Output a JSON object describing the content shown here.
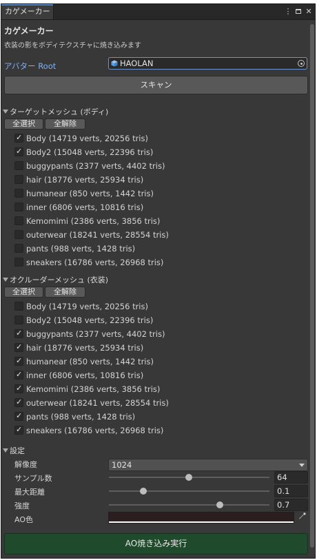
{
  "window": {
    "tab_title": "カゲメーカー",
    "icons": [
      "more-vert-icon",
      "maximize-icon",
      "close-icon"
    ]
  },
  "header": {
    "title": "カゲメーカー",
    "description": "衣装の影をボディテクスチャに焼き込みます"
  },
  "avatar": {
    "label": "アバター Root",
    "value": "HAOLAN"
  },
  "scan_button": "スキャン",
  "target_section": {
    "label": "ターゲットメッシュ (ボディ)",
    "select_all": "全選択",
    "deselect_all": "全解除",
    "items": [
      {
        "name": "Body",
        "info": "(14719 verts, 20256 tris)",
        "checked": true
      },
      {
        "name": "Body2",
        "info": "(15048 verts, 22396 tris)",
        "checked": true
      },
      {
        "name": "buggypants",
        "info": "(2377 verts, 4402 tris)",
        "checked": false
      },
      {
        "name": "hair",
        "info": "(18776 verts, 25934 tris)",
        "checked": false
      },
      {
        "name": "humanear",
        "info": "(850 verts, 1442 tris)",
        "checked": false
      },
      {
        "name": "inner",
        "info": "(6806 verts, 10816 tris)",
        "checked": false
      },
      {
        "name": "Kemomimi",
        "info": "(2386 verts, 3856 tris)",
        "checked": false
      },
      {
        "name": "outerwear",
        "info": "(18241 verts, 28554 tris)",
        "checked": false
      },
      {
        "name": "pants",
        "info": "(988 verts, 1428 tris)",
        "checked": false
      },
      {
        "name": "sneakers",
        "info": "(16786 verts, 26968 tris)",
        "checked": false
      }
    ]
  },
  "occluder_section": {
    "label": "オクルーダーメッシュ (衣装)",
    "select_all": "全選択",
    "deselect_all": "全解除",
    "items": [
      {
        "name": "Body",
        "info": "(14719 verts, 20256 tris)",
        "checked": false
      },
      {
        "name": "Body2",
        "info": "(15048 verts, 22396 tris)",
        "checked": false
      },
      {
        "name": "buggypants",
        "info": "(2377 verts, 4402 tris)",
        "checked": true
      },
      {
        "name": "hair",
        "info": "(18776 verts, 25934 tris)",
        "checked": true
      },
      {
        "name": "humanear",
        "info": "(850 verts, 1442 tris)",
        "checked": true
      },
      {
        "name": "inner",
        "info": "(6806 verts, 10816 tris)",
        "checked": true
      },
      {
        "name": "Kemomimi",
        "info": "(2386 verts, 3856 tris)",
        "checked": true
      },
      {
        "name": "outerwear",
        "info": "(18241 verts, 28554 tris)",
        "checked": true
      },
      {
        "name": "pants",
        "info": "(988 verts, 1428 tris)",
        "checked": true
      },
      {
        "name": "sneakers",
        "info": "(16786 verts, 26968 tris)",
        "checked": true
      }
    ]
  },
  "settings": {
    "label": "設定",
    "resolution": {
      "label": "解像度",
      "value": "1024"
    },
    "samples": {
      "label": "サンプル数",
      "value": "64",
      "min": 1,
      "max": 128
    },
    "max_distance": {
      "label": "最大距離",
      "value": "0.1",
      "min": 0,
      "max": 0.5
    },
    "intensity": {
      "label": "強度",
      "value": "0.7",
      "min": 0,
      "max": 1
    },
    "ao_color": {
      "label": "AO色",
      "color": "#2a1e1e"
    }
  },
  "run_button": "AO焼き込み実行",
  "colors": {
    "accent": "#4c80c9",
    "link": "#7fb1f4",
    "run_button_bg": "#1f4a2b"
  }
}
